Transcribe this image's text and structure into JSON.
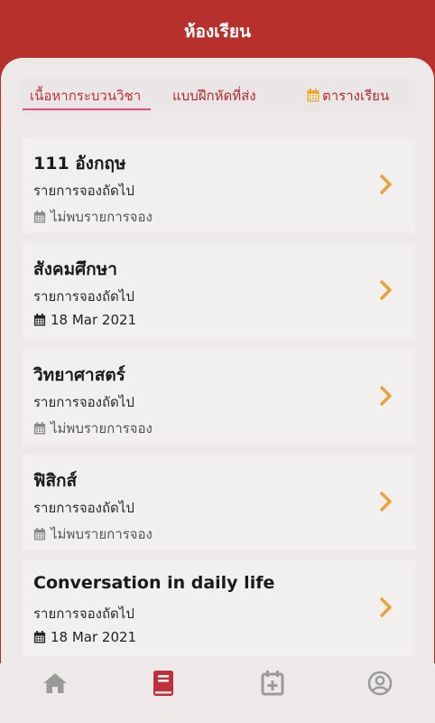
{
  "header": {
    "title": "ห้องเรียน"
  },
  "tabs": [
    {
      "label": "เนื้อหากระบวนวิชา",
      "active": true
    },
    {
      "label": "แบบฝึกหัดที่ส่ง",
      "active": false
    },
    {
      "label": "ตารางเรียน",
      "icon": "calendar-icon",
      "active": false
    }
  ],
  "courses": [
    {
      "title": "111 อังกฤษ",
      "subtitle": "รายการจองถัดไป",
      "date": "ไม่พบรายการจอง"
    },
    {
      "title": "สังคมศึกษา",
      "subtitle": "รายการจองถัดไป",
      "date": "18 Mar 2021"
    },
    {
      "title": "วิทยาศาสตร์",
      "subtitle": "รายการจองถัดไป",
      "date": "ไม่พบรายการจอง"
    },
    {
      "title": "ฟิสิกส์",
      "subtitle": "รายการจองถัดไป",
      "date": "ไม่พบรายการจอง"
    },
    {
      "title": "Conversation in daily life",
      "subtitle": "รายการจองถัดไป",
      "date": "18 Mar 2021"
    }
  ],
  "bottom_nav": [
    {
      "icon": "home-icon",
      "active": false
    },
    {
      "icon": "book-icon",
      "active": true
    },
    {
      "icon": "calendar-add-icon",
      "active": false
    },
    {
      "icon": "account-icon",
      "active": false
    }
  ],
  "colors": {
    "header": "#b7302c",
    "accent": "#b7302c",
    "chevron": "#e8a23a",
    "tab_underline": "#e0507a",
    "inactive_icon": "#9a9a9a"
  }
}
